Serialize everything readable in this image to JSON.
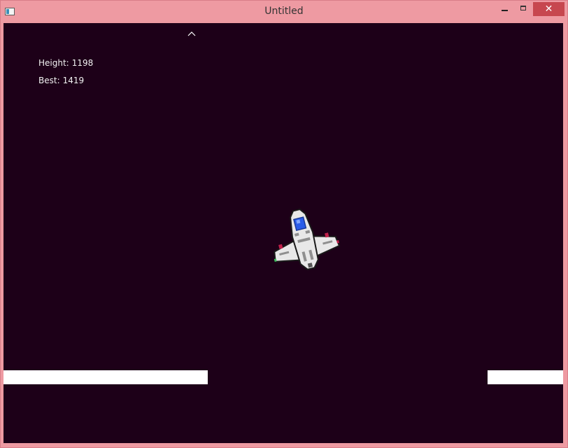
{
  "window": {
    "title": "Untitled",
    "close_glyph": "✕",
    "icons": {
      "app": "app-window-icon",
      "minimize": "minimize-icon",
      "maximize": "maximize-icon",
      "close": "close-icon"
    },
    "colors": {
      "frame": "#ee9aa2",
      "close_button": "#c7474f"
    }
  },
  "game": {
    "background": "#1d0018",
    "hud": {
      "height_label": "Height:",
      "height_value": "1198",
      "best_label": "Best:",
      "best_value": "1419"
    },
    "indicator_icon": "caret-up-icon",
    "player_icon": "spaceship-icon",
    "platform_color": "#ffffff",
    "ship_colors": {
      "hull": "#e8e8e8",
      "outline": "#1a1a1a",
      "shade": "#8f8f8f",
      "cockpit": "#2a5ce8",
      "lights": "#c0204a"
    }
  }
}
